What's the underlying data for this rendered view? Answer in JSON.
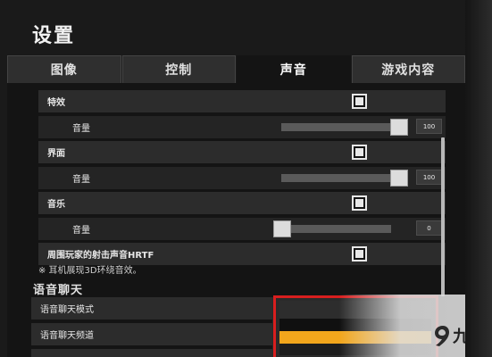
{
  "window": {
    "title": "设置"
  },
  "tabs": [
    {
      "label": "图像",
      "active": false
    },
    {
      "label": "控制",
      "active": false
    },
    {
      "label": "声音",
      "active": true
    },
    {
      "label": "游戏内容",
      "active": false
    }
  ],
  "sound": {
    "effects": {
      "label": "特效",
      "enabled": true,
      "volume_label": "音量",
      "volume_value": "100",
      "level": 1.0
    },
    "interface": {
      "label": "界面",
      "enabled": true,
      "volume_label": "音量",
      "volume_value": "100",
      "level": 1.0
    },
    "music": {
      "label": "音乐",
      "enabled": true,
      "volume_label": "音量",
      "volume_value": "0",
      "level": 0.0
    },
    "hrtf": {
      "label": "周围玩家的射击声音HRTF",
      "enabled": true
    },
    "note": "※ 耳机展现3D环绕音效。"
  },
  "voice_chat": {
    "section_title": "语音聊天",
    "mode_label": "语音聊天模式",
    "channel_label": "语音聊天频道"
  },
  "colors": {
    "accent": "#f2a61c",
    "highlight_frame": "#d81e1e"
  },
  "watermark": {
    "logo_text": "九游",
    "icon": "nine-game-logo-icon"
  }
}
